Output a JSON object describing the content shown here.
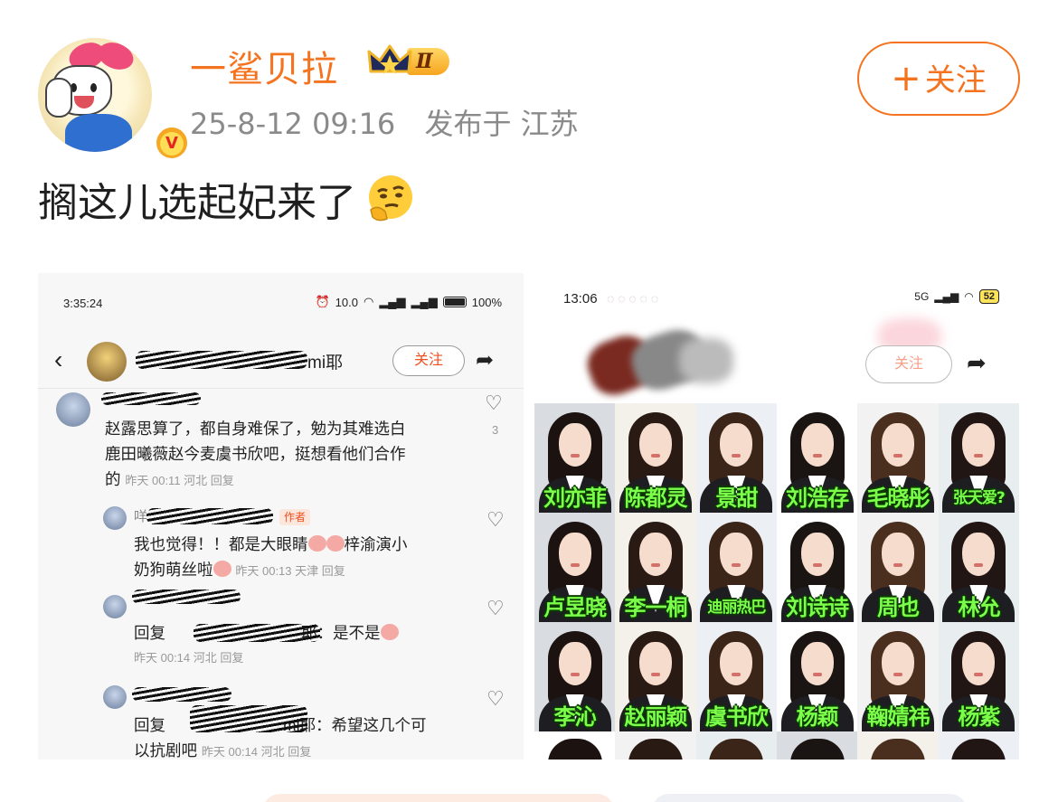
{
  "post": {
    "username": "一鲨贝拉",
    "level": "Ⅱ",
    "time": "25-8-12 09:16",
    "location": "发布于 江苏",
    "follow_label": "关注",
    "follow_plus": "+",
    "verified_mark": "V",
    "text": "搁这儿选起妃来了"
  },
  "left_shot": {
    "status_time": "3:35:24",
    "status_net": "10.0",
    "status_battery": "100%",
    "nav_name_suffix": "mi耶",
    "follow_label": "关注",
    "comments": [
      {
        "text_line1": "赵露思算了，都自身难保了，勉为其难选白",
        "text_line2": "鹿田曦薇赵今麦虞书欣吧，挺想看他们合作",
        "text_line3": "的",
        "meta": "昨天 00:11 河北 回复",
        "likes": "3"
      },
      {
        "author_tag": "作者",
        "name_prefix": "咩",
        "text_line1": "我也觉得！！都是大眼睛",
        "text_line1b": "梓渝演小",
        "text_line2": "奶狗萌丝啦",
        "meta": "昨天 00:13 天津 回复"
      },
      {
        "text": "回复",
        "text_suffix": "耶：是不是",
        "meta": "昨天 00:14 河北 回复"
      },
      {
        "text": "回复",
        "text_suffix": "mi耶：希望这几个可",
        "text_line2": "以抗剧吧",
        "meta": "昨天 00:14 河北 回复"
      }
    ]
  },
  "right_shot": {
    "status_time": "13:06",
    "status_net": "5G",
    "status_battery": "52",
    "follow_label": "关注",
    "names": [
      "刘亦菲",
      "陈都灵",
      "景甜",
      "刘浩存",
      "毛晓彤",
      "张天爱?",
      "卢昱晓",
      "李一桐",
      "迪丽热巴",
      "刘诗诗",
      "周也",
      "林允",
      "李沁",
      "赵丽颖",
      "虞书欣",
      "杨颖",
      "鞠婧祎",
      "杨紫"
    ]
  },
  "colors": {
    "accent": "#f4731f",
    "name_green": "#7cff4a",
    "meta_gray": "#8a8a8a"
  }
}
